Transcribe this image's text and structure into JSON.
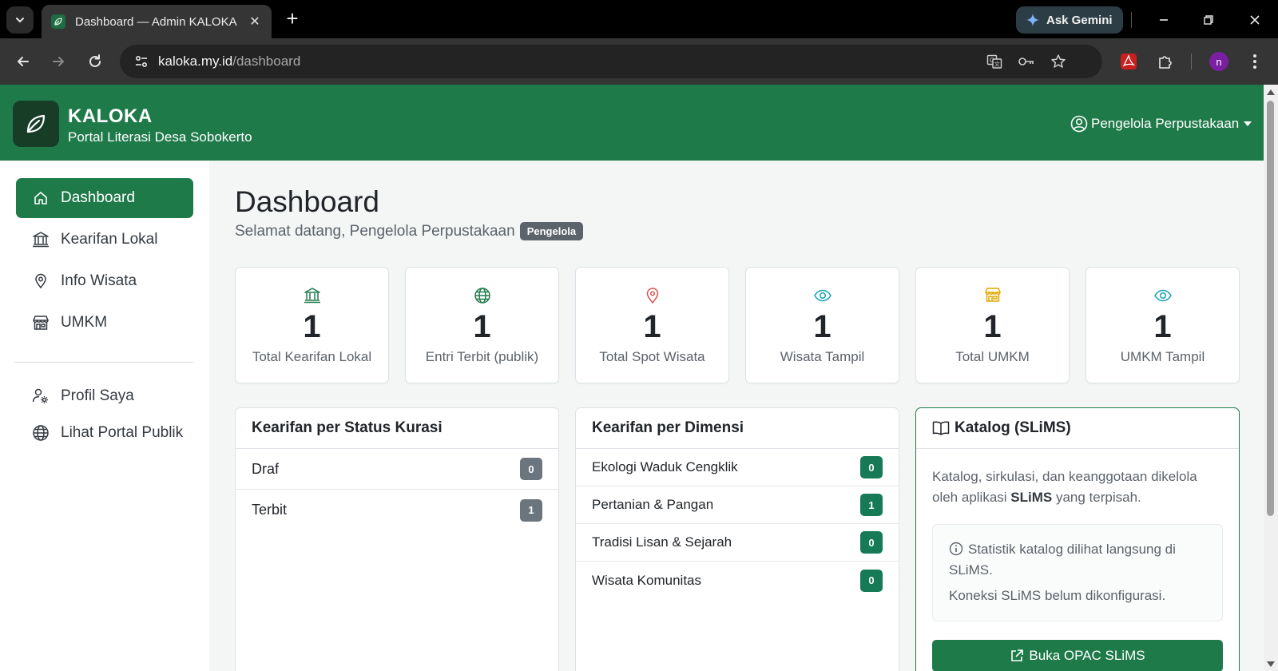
{
  "browser": {
    "tab_title": "Dashboard — Admin KALOKA",
    "tab_close": "✕",
    "new_tab": "+",
    "gemini_label": "Ask Gemini",
    "url_domain": "kaloka.my.id",
    "url_path": "/dashboard",
    "profile_initial": "n"
  },
  "header": {
    "brand_name": "KALOKA",
    "brand_subtitle": "Portal Literasi Desa Sobokerto",
    "user_menu_label": "Pengelola Perpustakaan"
  },
  "sidebar": {
    "items": [
      {
        "label": "Dashboard",
        "icon": "home-icon",
        "active": true
      },
      {
        "label": "Kearifan Lokal",
        "icon": "bank-icon"
      },
      {
        "label": "Info Wisata",
        "icon": "map-pin-icon"
      },
      {
        "label": "UMKM",
        "icon": "shop-icon"
      },
      {
        "label": "Profil Saya",
        "icon": "user-gear-icon"
      },
      {
        "label": "Lihat Portal Publik",
        "icon": "globe-icon"
      }
    ]
  },
  "main": {
    "title": "Dashboard",
    "welcome": "Selamat datang, Pengelola Perpustakaan",
    "role_badge": "Pengelola",
    "stats": [
      {
        "value": "1",
        "label": "Total Kearifan Lokal",
        "icon": "bank-icon",
        "color": "#1f7a4a"
      },
      {
        "value": "1",
        "label": "Entri Terbit (publik)",
        "icon": "globe-icon",
        "color": "#1f7a4a"
      },
      {
        "value": "1",
        "label": "Total Spot Wisata",
        "icon": "map-pin-icon",
        "color": "#d9534f"
      },
      {
        "value": "1",
        "label": "Wisata Tampil",
        "icon": "eye-icon",
        "color": "#17a2b8"
      },
      {
        "value": "1",
        "label": "Total UMKM",
        "icon": "shop-icon",
        "color": "#e0a800"
      },
      {
        "value": "1",
        "label": "UMKM Tampil",
        "icon": "eye-icon",
        "color": "#17a2b8"
      }
    ],
    "status_panel": {
      "title": "Kearifan per Status Kurasi",
      "rows": [
        {
          "label": "Draf",
          "count": "0"
        },
        {
          "label": "Terbit",
          "count": "1"
        }
      ]
    },
    "dimensi_panel": {
      "title": "Kearifan per Dimensi",
      "rows": [
        {
          "label": "Ekologi Waduk Cengklik",
          "count": "0"
        },
        {
          "label": "Pertanian & Pangan",
          "count": "1"
        },
        {
          "label": "Tradisi Lisan & Sejarah",
          "count": "0"
        },
        {
          "label": "Wisata Komunitas",
          "count": "0"
        }
      ]
    },
    "katalog_panel": {
      "title": "Katalog (SLiMS)",
      "desc_before": "Katalog, sirkulasi, dan keanggotaan dikelola oleh aplikasi ",
      "desc_bold": "SLiMS",
      "desc_after": " yang terpisah.",
      "info_line1": "Statistik katalog dilihat langsung di SLiMS.",
      "info_line2": "Koneksi SLiMS belum dikonfigurasi.",
      "button_label": "Buka OPAC SLiMS"
    }
  },
  "colors": {
    "brand_green": "#1f7a4a",
    "brand_dark": "#173d27",
    "badge_gray": "#6c757d",
    "badge_green": "#157a55"
  }
}
